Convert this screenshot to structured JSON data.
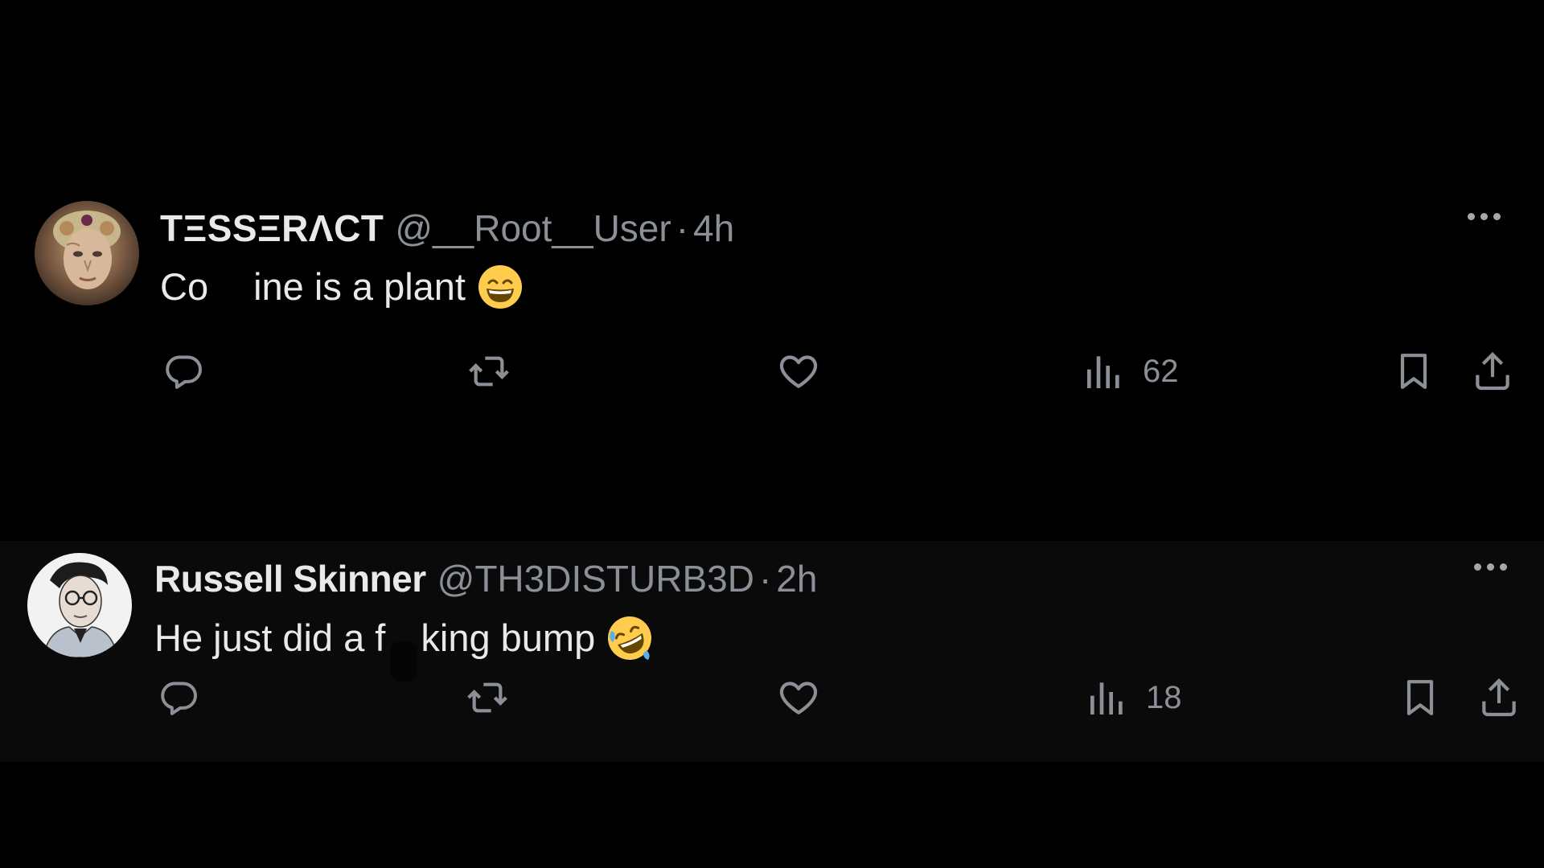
{
  "tweets": [
    {
      "display_name": "TESSERACT",
      "display_name_render": "TΞSSΞRΛCT",
      "handle": "@__Root__User",
      "separator": "·",
      "time": "4h",
      "text_before": "Co",
      "text_after": "ine is a plant",
      "emoji": "grinning-face-with-smiling-eyes",
      "views": "62",
      "avatar": "ornate-portrait-avatar"
    },
    {
      "display_name": "Russell Skinner",
      "handle": "@TH3DISTURB3D",
      "separator": "·",
      "time": "2h",
      "text_before": "He just did a f",
      "text_after": "king bump",
      "emoji": "rolling-on-the-floor-laughing",
      "views": "18",
      "avatar": "sketch-man-avatar"
    }
  ],
  "icons": {
    "reply": "reply-icon",
    "repost": "repost-icon",
    "like": "heart-icon",
    "views": "views-chart-icon",
    "bookmark": "bookmark-icon",
    "share": "share-icon",
    "more": "more-dots-icon"
  },
  "colors": {
    "background": "#000000",
    "secondary_text": "#8b9096",
    "primary_text": "#e7e9ea",
    "emoji_yellow": "#ffcc4d"
  }
}
